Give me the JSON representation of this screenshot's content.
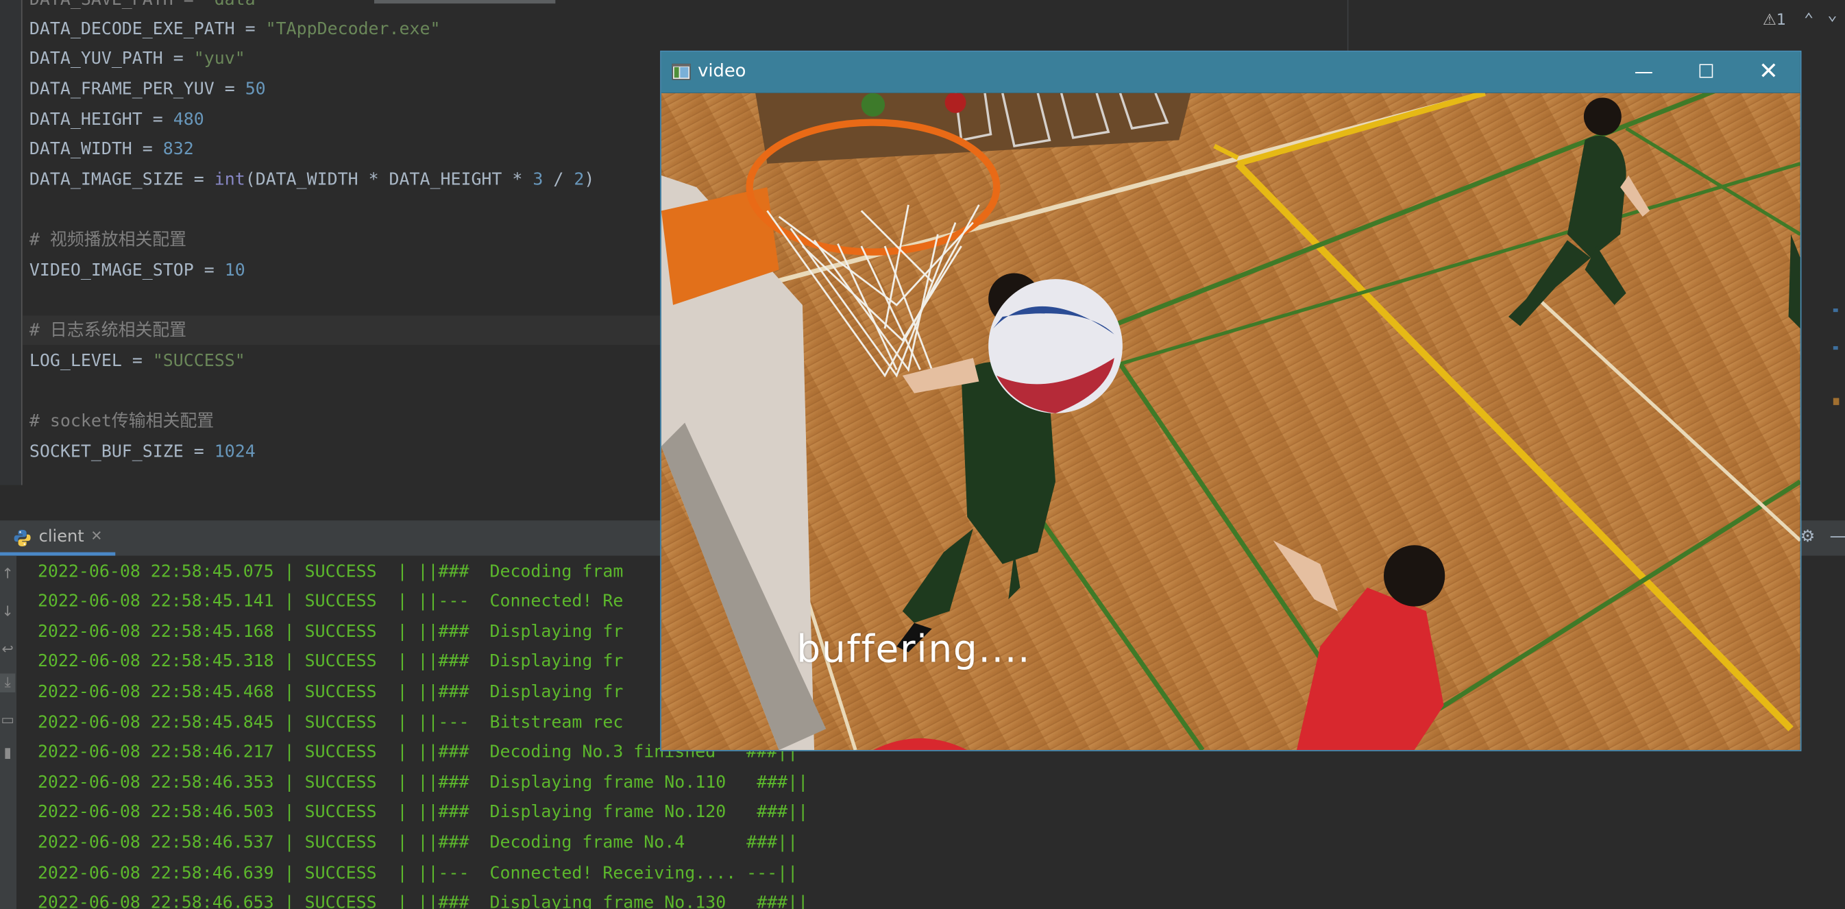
{
  "editor": {
    "lines": [
      {
        "name": "DATA_DECODE_EXE_PATH",
        "value": "\"TAppDecoder.exe\"",
        "kind": "str"
      },
      {
        "name": "DATA_YUV_PATH",
        "value": "\"yuv\"",
        "kind": "str"
      },
      {
        "name": "DATA_FRAME_PER_YUV",
        "value": "50",
        "kind": "num"
      },
      {
        "name": "DATA_HEIGHT",
        "value": "480",
        "kind": "num"
      },
      {
        "name": "DATA_WIDTH",
        "value": "832",
        "kind": "num"
      }
    ],
    "image_size": {
      "name": "DATA_IMAGE_SIZE",
      "fn": "int",
      "expr_a": "(DATA_WIDTH * DATA_HEIGHT * ",
      "n1": "3",
      "expr_b": " / ",
      "n2": "2",
      "expr_c": ")"
    },
    "comment_video": "# 视频播放相关配置",
    "video_stop": {
      "name": "VIDEO_IMAGE_STOP",
      "value": "10"
    },
    "comment_log": "# 日志系统相关配置",
    "log_level": {
      "name": "LOG_LEVEL",
      "value": "\"SUCCESS\""
    },
    "comment_socket": "# socket传输相关配置",
    "socket_buf": {
      "name": "SOCKET_BUF_SIZE",
      "value": "1024"
    },
    "eq": " = ",
    "warning_count": "1"
  },
  "run_panel": {
    "tab_label": "client",
    "logs": [
      {
        "time": "2022-06-08 22:58:45.075",
        "level": "SUCCESS ",
        "msg": "||###  Decoding fram"
      },
      {
        "time": "2022-06-08 22:58:45.141",
        "level": "SUCCESS ",
        "msg": "||---  Connected! Re"
      },
      {
        "time": "2022-06-08 22:58:45.168",
        "level": "SUCCESS ",
        "msg": "||###  Displaying fr"
      },
      {
        "time": "2022-06-08 22:58:45.318",
        "level": "SUCCESS ",
        "msg": "||###  Displaying fr"
      },
      {
        "time": "2022-06-08 22:58:45.468",
        "level": "SUCCESS ",
        "msg": "||###  Displaying fr"
      },
      {
        "time": "2022-06-08 22:58:45.845",
        "level": "SUCCESS ",
        "msg": "||---  Bitstream rec"
      },
      {
        "time": "2022-06-08 22:58:46.217",
        "level": "SUCCESS ",
        "msg": "||###  Decoding No.3 finished   ###||"
      },
      {
        "time": "2022-06-08 22:58:46.353",
        "level": "SUCCESS ",
        "msg": "||###  Displaying frame No.110   ###||"
      },
      {
        "time": "2022-06-08 22:58:46.503",
        "level": "SUCCESS ",
        "msg": "||###  Displaying frame No.120   ###||"
      },
      {
        "time": "2022-06-08 22:58:46.537",
        "level": "SUCCESS ",
        "msg": "||###  Decoding frame No.4      ###||"
      },
      {
        "time": "2022-06-08 22:58:46.639",
        "level": "SUCCESS ",
        "msg": "||---  Connected! Receiving.... ---||"
      },
      {
        "time": "2022-06-08 22:58:46.653",
        "level": "SUCCESS ",
        "msg": "||###  Displaying frame No.130   ###||"
      }
    ]
  },
  "video_window": {
    "title": "video",
    "overlay_text": "buffering...."
  },
  "colors": {
    "editor_bg": "#2b2b2b",
    "log_green": "#5cb82c",
    "titlebar": "#3a7f9a",
    "court": "#b5773a"
  }
}
